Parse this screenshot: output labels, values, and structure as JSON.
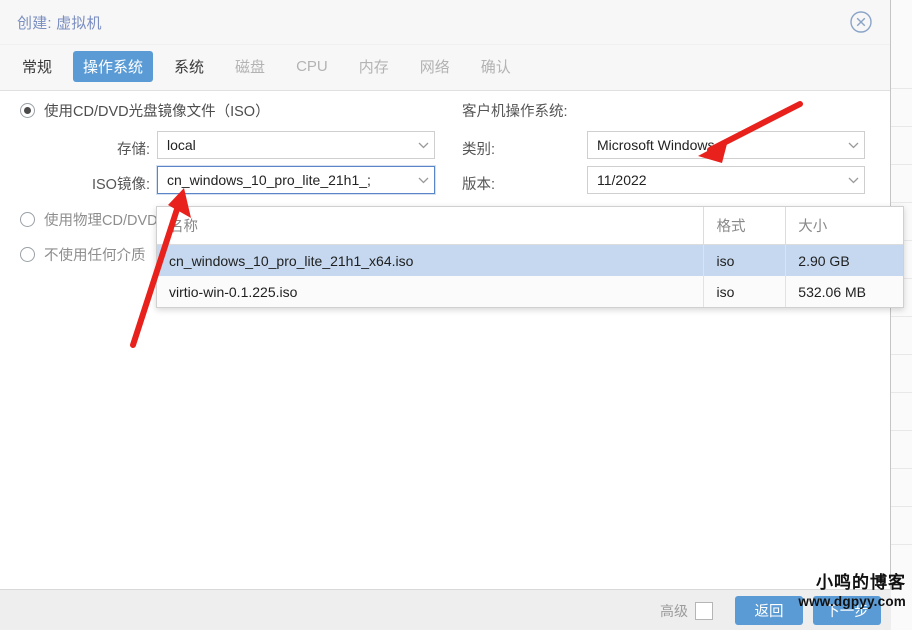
{
  "window": {
    "title": "创建: 虚拟机",
    "close_icon": "close-circle-icon"
  },
  "tabs": [
    {
      "label": "常规",
      "state": "enabled"
    },
    {
      "label": "操作系统",
      "state": "active"
    },
    {
      "label": "系统",
      "state": "enabled"
    },
    {
      "label": "磁盘",
      "state": "disabled"
    },
    {
      "label": "CPU",
      "state": "disabled"
    },
    {
      "label": "内存",
      "state": "disabled"
    },
    {
      "label": "网络",
      "state": "disabled"
    },
    {
      "label": "确认",
      "state": "disabled"
    }
  ],
  "media": {
    "options": [
      {
        "label": "使用CD/DVD光盘镜像文件（ISO）",
        "checked": true,
        "dim": false
      },
      {
        "label": "使用物理CD/DVD驱动器",
        "checked": false,
        "dim": true
      },
      {
        "label": "不使用任何介质",
        "checked": false,
        "dim": true
      }
    ],
    "storage_label": "存储:",
    "storage_value": "local",
    "iso_label": "ISO镜像:",
    "iso_value": "cn_windows_10_pro_lite_21h1_;"
  },
  "guest_os": {
    "section_label": "客户机操作系统:",
    "type_label": "类别:",
    "type_value": "Microsoft Windows",
    "version_label": "版本:",
    "version_value": "11/2022"
  },
  "iso_dropdown": {
    "columns": [
      "名称",
      "格式",
      "大小"
    ],
    "rows": [
      {
        "name": "cn_windows_10_pro_lite_21h1_x64.iso",
        "format": "iso",
        "size": "2.90 GB",
        "selected": true
      },
      {
        "name": "virtio-win-0.1.225.iso",
        "format": "iso",
        "size": "532.06 MB",
        "selected": false
      }
    ]
  },
  "footer": {
    "advanced_label": "高级",
    "back_label": "返回",
    "next_label": "下一步"
  },
  "watermark": {
    "line1": "小鸣的博客",
    "line2": "www.dgpyy.com"
  },
  "colors": {
    "accent": "#5b9bd5",
    "title": "#7a8ec0",
    "selection": "#c5d8ef",
    "annotation": "#e8211c"
  }
}
